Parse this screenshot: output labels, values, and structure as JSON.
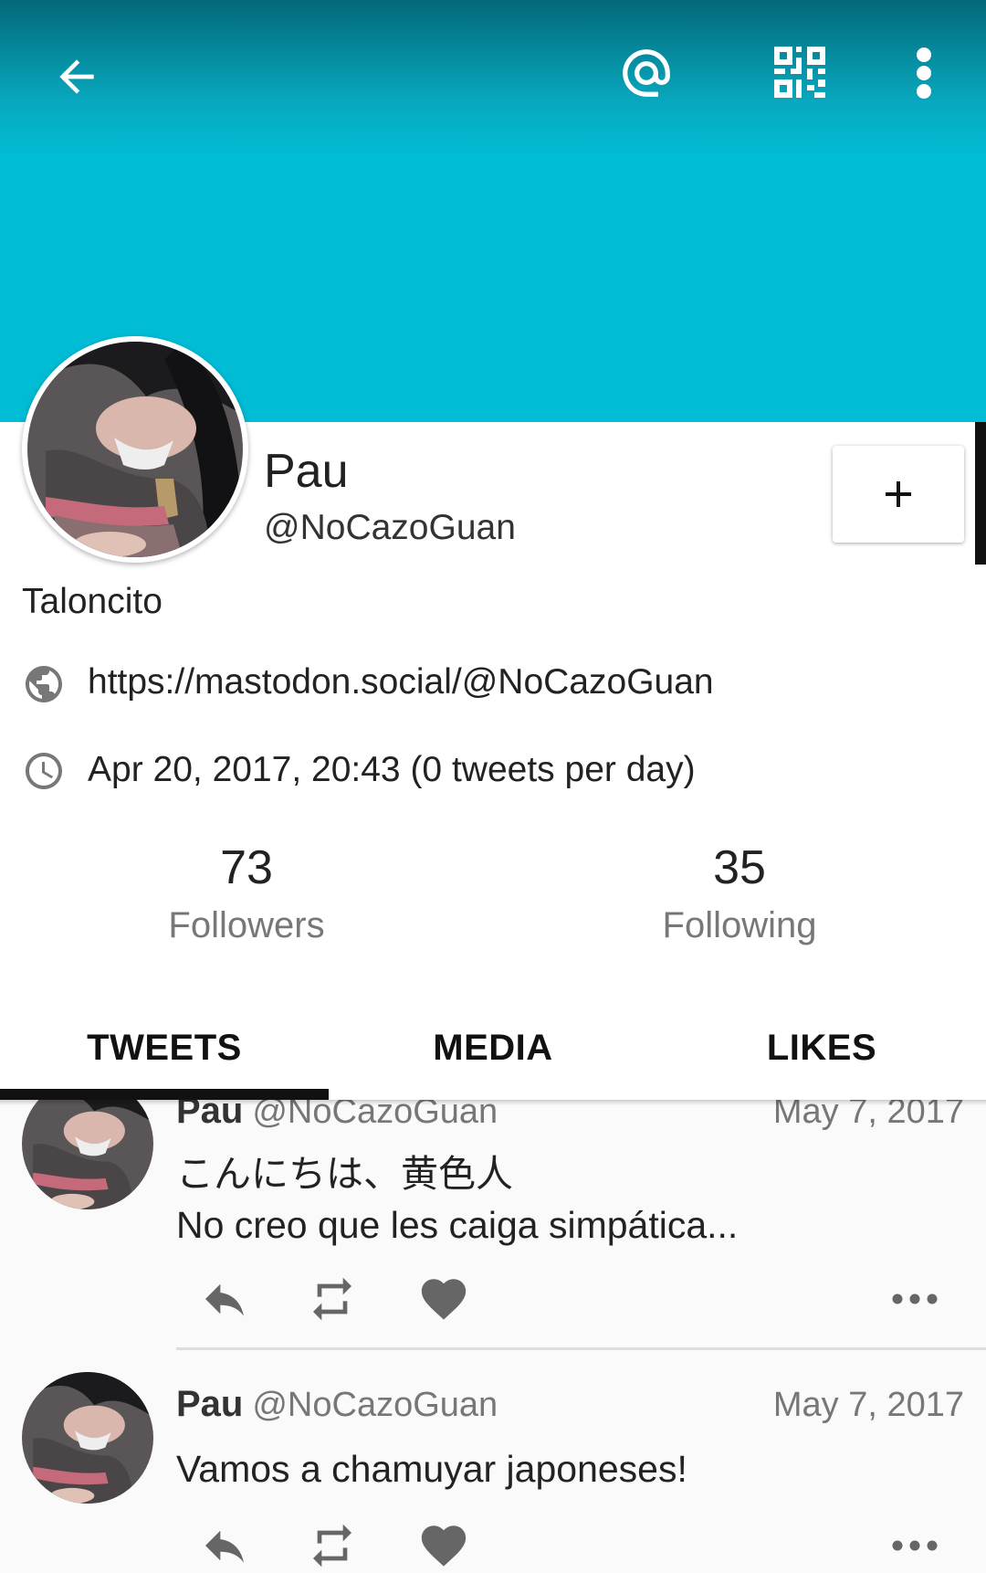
{
  "toolbar": {
    "back_icon": "arrow-back-icon",
    "mention_icon": "at-icon",
    "qr_icon": "qr-code-icon",
    "more_icon": "more-vert-icon",
    "banner_color": "#00bcd4"
  },
  "profile": {
    "name": "Pau",
    "handle": "@NoCazoGuan",
    "bio": "Taloncito",
    "website": "https://mastodon.social/@NoCazoGuan",
    "joined": "Apr 20, 2017, 20:43 (0 tweets per day)",
    "follow_button_icon": "plus-icon",
    "followers_count": "73",
    "followers_label": "Followers",
    "following_count": "35",
    "following_label": "Following"
  },
  "tabs": [
    {
      "label": "TWEETS",
      "active": true
    },
    {
      "label": "MEDIA",
      "active": false
    },
    {
      "label": "LIKES",
      "active": false
    }
  ],
  "tweets": [
    {
      "name": "Pau",
      "handle": "@NoCazoGuan",
      "date": "May 7, 2017",
      "text": "こんにちは、黄色人\nNo creo que les caiga simpática..."
    },
    {
      "name": "Pau",
      "handle": "@NoCazoGuan",
      "date": "May 7, 2017",
      "text": "Vamos a chamuyar japoneses!"
    }
  ]
}
